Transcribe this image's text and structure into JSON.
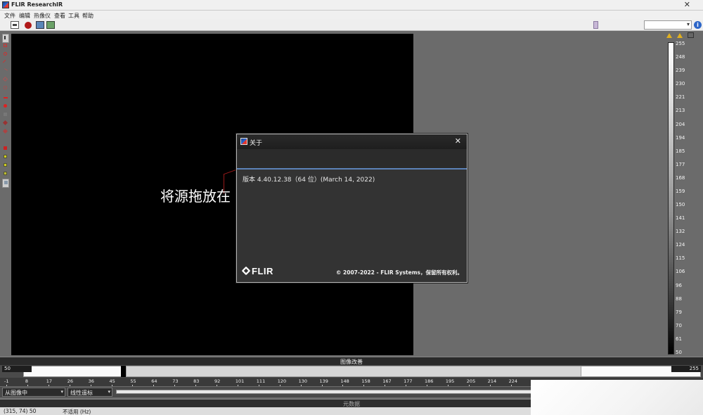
{
  "window": {
    "title": "FLIR ResearchIR",
    "close_glyph": "✕"
  },
  "menu": [
    "文件",
    "编辑",
    "热像仪",
    "查看",
    "工具",
    "帮助"
  ],
  "toolbar": {
    "info_glyph": "i",
    "combo_arrow": "▾"
  },
  "viewer": {
    "drop_text": "将源拖放在"
  },
  "scale": {
    "labels": [
      "255",
      "248",
      "239",
      "230",
      "221",
      "213",
      "204",
      "194",
      "185",
      "177",
      "168",
      "159",
      "150",
      "141",
      "132",
      "124",
      "115",
      "106",
      "96",
      "88",
      "79",
      "70",
      "61",
      "50"
    ]
  },
  "about_dialog": {
    "title": "关于",
    "close_glyph": "✕",
    "version": "版本 4.40.12.38（64 位）(March 14, 2022)",
    "logo_text": "FLIR",
    "copyright": "© 2007-2022 - FLIR Systems，保留所有权利。"
  },
  "image_adjust": {
    "header": "图像改善",
    "min_value": "50",
    "max_value": "255",
    "ruler_ticks": [
      "-1",
      "8",
      "17",
      "26",
      "36",
      "45",
      "55",
      "64",
      "73",
      "83",
      "92",
      "101",
      "111",
      "120",
      "130",
      "139",
      "148",
      "158",
      "167",
      "177",
      "186",
      "195",
      "205",
      "214",
      "224"
    ],
    "source_select": "从图像中",
    "mode_select": "线性遥标",
    "select_arrow": "▾"
  },
  "metadata": {
    "header": "元数据"
  },
  "status": {
    "coords": "(315, 74) 50",
    "freq": "不适用 (Hz)"
  }
}
